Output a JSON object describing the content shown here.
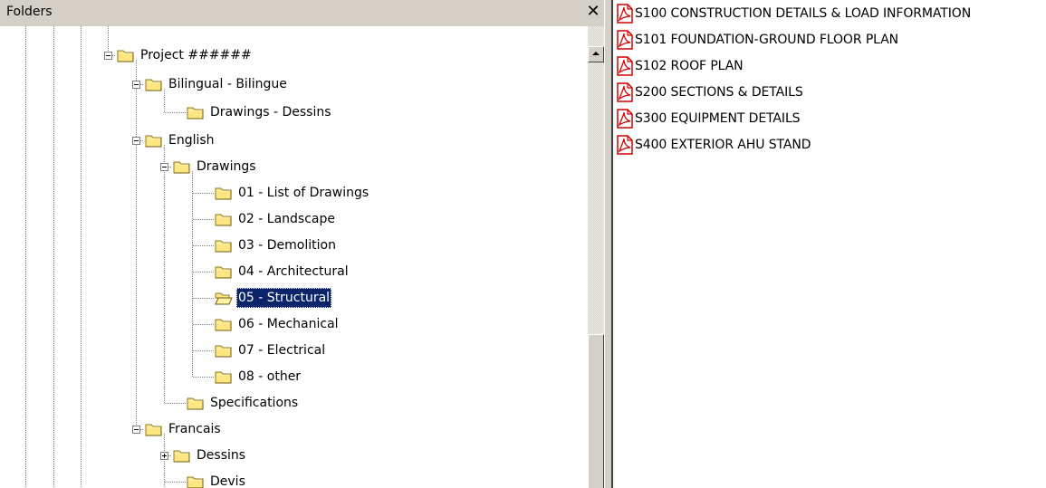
{
  "folders_pane": {
    "title": "Folders",
    "close_glyph": "✕"
  },
  "tree": {
    "items": [
      {
        "label": "Project ######",
        "expander": "minus",
        "icon": "folder-closed"
      },
      {
        "label": "Bilingual - Bilingue",
        "expander": "minus",
        "icon": "folder-closed"
      },
      {
        "label": "Drawings - Dessins",
        "expander": "none",
        "icon": "folder-closed"
      },
      {
        "label": "English",
        "expander": "minus",
        "icon": "folder-closed"
      },
      {
        "label": "Drawings",
        "expander": "minus",
        "icon": "folder-closed"
      },
      {
        "label": "01 - List of Drawings",
        "expander": "none",
        "icon": "folder-closed"
      },
      {
        "label": "02 - Landscape",
        "expander": "none",
        "icon": "folder-closed"
      },
      {
        "label": "03 - Demolition",
        "expander": "none",
        "icon": "folder-closed"
      },
      {
        "label": "04 - Architectural",
        "expander": "none",
        "icon": "folder-closed"
      },
      {
        "label": "05 - Structural",
        "expander": "none",
        "icon": "folder-open",
        "selected": true
      },
      {
        "label": "06 - Mechanical",
        "expander": "none",
        "icon": "folder-closed"
      },
      {
        "label": "07 - Electrical",
        "expander": "none",
        "icon": "folder-closed"
      },
      {
        "label": "08 - other",
        "expander": "none",
        "icon": "folder-closed"
      },
      {
        "label": "Specifications",
        "expander": "none",
        "icon": "folder-closed"
      },
      {
        "label": "Francais",
        "expander": "minus",
        "icon": "folder-closed"
      },
      {
        "label": "Dessins",
        "expander": "plus",
        "icon": "folder-closed"
      },
      {
        "label": "Devis",
        "expander": "none",
        "icon": "folder-closed"
      }
    ]
  },
  "files": {
    "icon": "pdf-icon",
    "items": [
      {
        "label": "S100 CONSTRUCTION DETAILS & LOAD INFORMATION"
      },
      {
        "label": "S101 FOUNDATION-GROUND FLOOR PLAN"
      },
      {
        "label": "S102 ROOF PLAN"
      },
      {
        "label": "S200 SECTIONS & DETAILS"
      },
      {
        "label": "S300 EQUIPMENT DETAILS"
      },
      {
        "label": "S400 EXTERIOR AHU STAND"
      }
    ]
  },
  "colors": {
    "selection": "#0a246a",
    "chrome": "#d4d0c8",
    "folder_fill": "#ffe680",
    "pdf_red": "#d40000"
  }
}
